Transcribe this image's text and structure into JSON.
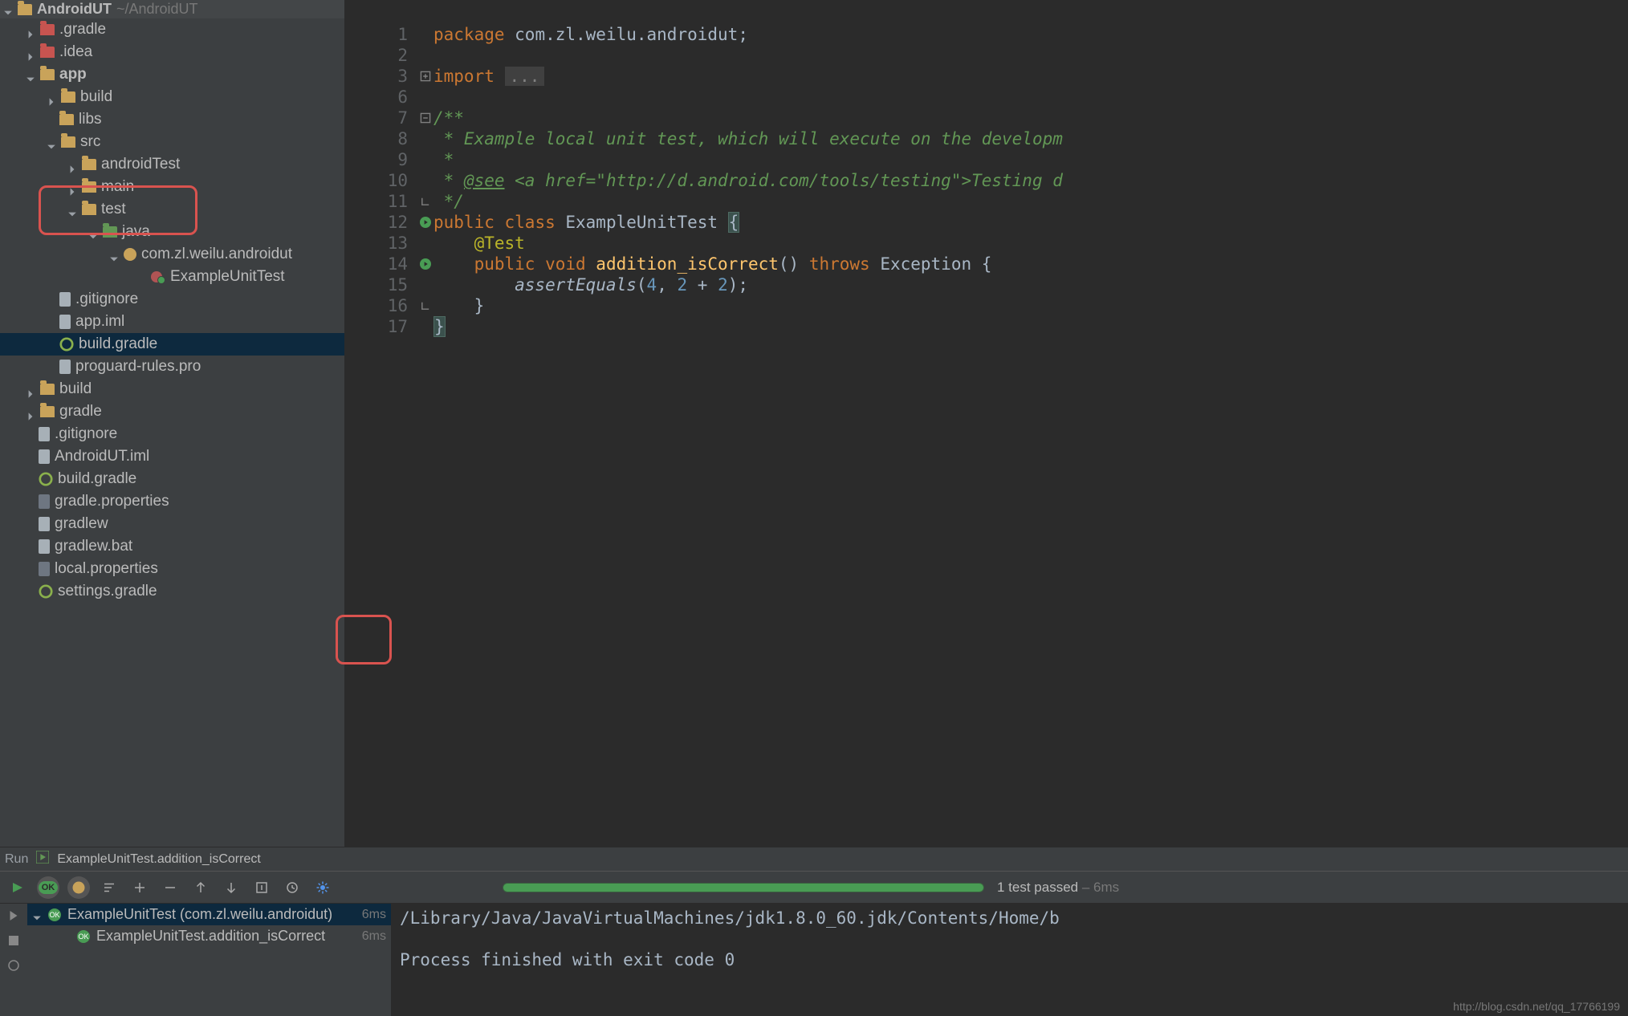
{
  "project": {
    "name": "AndroidUT",
    "path": "~/AndroidUT"
  },
  "tree": {
    "gradle": ".gradle",
    "idea": ".idea",
    "app": "app",
    "app_build": "build",
    "app_libs": "libs",
    "app_src": "src",
    "androidTest": "androidTest",
    "main": "main",
    "test": "test",
    "java": "java",
    "pkg": "com.zl.weilu.androidut",
    "example_test": "ExampleUnitTest",
    "gitignore": ".gitignore",
    "app_iml": "app.iml",
    "build_gradle": "build.gradle",
    "proguard": "proguard-rules.pro",
    "root_build": "build",
    "root_gradle": "gradle",
    "root_gitignore": ".gitignore",
    "android_iml": "AndroidUT.iml",
    "root_build_gradle": "build.gradle",
    "gradle_props": "gradle.properties",
    "gradlew": "gradlew",
    "gradlew_bat": "gradlew.bat",
    "local_props": "local.properties",
    "settings_gradle": "settings.gradle"
  },
  "editor": {
    "line_numbers": [
      "1",
      "2",
      "3",
      "6",
      "7",
      "8",
      "9",
      "10",
      "11",
      "12",
      "13",
      "14",
      "15",
      "16",
      "17"
    ],
    "code": {
      "l1_kw": "package ",
      "l1_pkg": "com.zl.weilu.androidut",
      "l1_semi": ";",
      "l3_kw": "import ",
      "l3_rest": "...",
      "l7": "/**",
      "l8": " * Example local unit test, which will execute on the developm",
      "l9": " *",
      "l10a": " * ",
      "l10tag": "@see",
      "l10b": " <a href=\"http://d.android.com/tools/testing\">Testing d",
      "l11": " */",
      "l12_kw1": "public ",
      "l12_kw2": "class ",
      "l12_cls": "ExampleUnitTest ",
      "l12_br": "{",
      "l13": "    @Test",
      "l14_kw1": "    public ",
      "l14_kw2": "void ",
      "l14_fn": "addition_isCorrect",
      "l14_p": "() ",
      "l14_kw3": "throws ",
      "l14_ex": "Exception {",
      "l15a": "        assertEquals",
      "l15p1": "(",
      "l15n1": "4",
      "l15c1": ", ",
      "l15n2": "2",
      "l15op": " + ",
      "l15n3": "2",
      "l15p2": ");",
      "l16": "    }",
      "l17": "}"
    }
  },
  "run": {
    "tab_label": "Run",
    "config": "ExampleUnitTest.addition_isCorrect"
  },
  "results": {
    "summary_passed": "1 test passed",
    "summary_time": " – 6ms",
    "root": "ExampleUnitTest (com.zl.weilu.androidut)",
    "root_time": "6ms",
    "child": "ExampleUnitTest.addition_isCorrect",
    "child_time": "6ms"
  },
  "console": {
    "l1": "/Library/Java/JavaVirtualMachines/jdk1.8.0_60.jdk/Contents/Home/b",
    "l2": "",
    "l3": "Process finished with exit code 0"
  },
  "watermark": "http://blog.csdn.net/qq_17766199"
}
